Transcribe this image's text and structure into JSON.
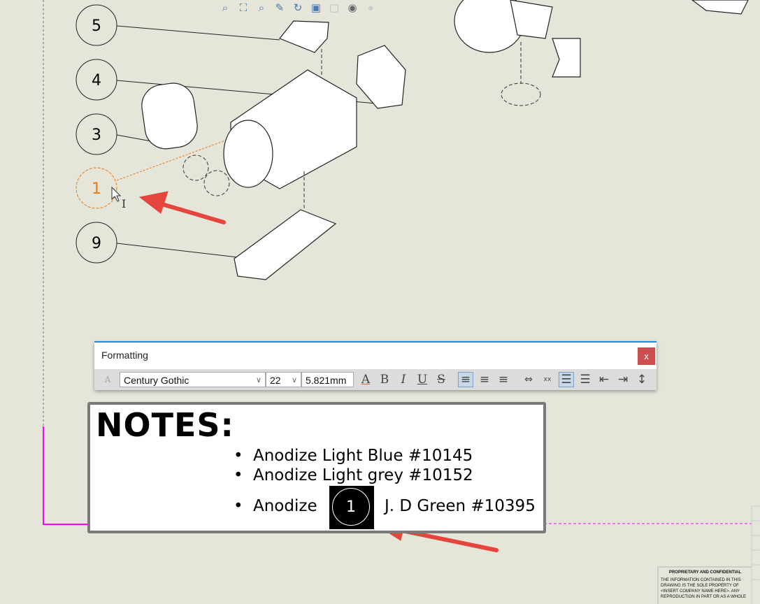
{
  "view_toolbar": {
    "icons": [
      "zoom-to-fit-icon",
      "zoom-to-area-icon",
      "zoom-selection-icon",
      "pan-icon",
      "rotate-icon",
      "view-orientation-icon",
      "display-style-icon",
      "hide-show-icon",
      "appearance-icon"
    ]
  },
  "balloons": [
    {
      "label": "5"
    },
    {
      "label": "4"
    },
    {
      "label": "3"
    },
    {
      "label": "1",
      "selected": true
    },
    {
      "label": "9"
    }
  ],
  "colors": {
    "selected_balloon": "#e87a1a",
    "sheet_border": "#ff00ff",
    "annotation_arrow": "#e5453c",
    "close": "#c9504f"
  },
  "formatting": {
    "title": "Formatting",
    "close_label": "x",
    "font": "Century Gothic",
    "size": "22",
    "height": "5.821mm",
    "buttons": [
      "font-color",
      "bold",
      "italic",
      "underline",
      "strikethrough",
      "align-left",
      "align-center",
      "align-right",
      "fit-text",
      "stack",
      "bullets",
      "numbering",
      "decrease-indent",
      "increase-indent",
      "line-spacing"
    ],
    "labels": {
      "color": "A",
      "bold": "B",
      "italic": "I",
      "underline": "U",
      "strike": "S"
    }
  },
  "notes": {
    "heading": "NOTES:",
    "bullet": "•",
    "items": [
      "Anodize Light Blue  #10145",
      "Anodize Light grey  #10152"
    ],
    "item3_prefix": "Anodize",
    "item3_balloon": "1",
    "item3_suffix": "J. D Green #10395"
  },
  "title_block": {
    "heading": "PROPRIETARY AND CONFIDENTIAL",
    "text": "THE INFORMATION CONTAINED IN THIS DRAWING IS THE SOLE PROPERTY OF <INSERT COMPANY NAME HERE>. ANY REPRODUCTION IN PART OR AS A WHOLE"
  }
}
